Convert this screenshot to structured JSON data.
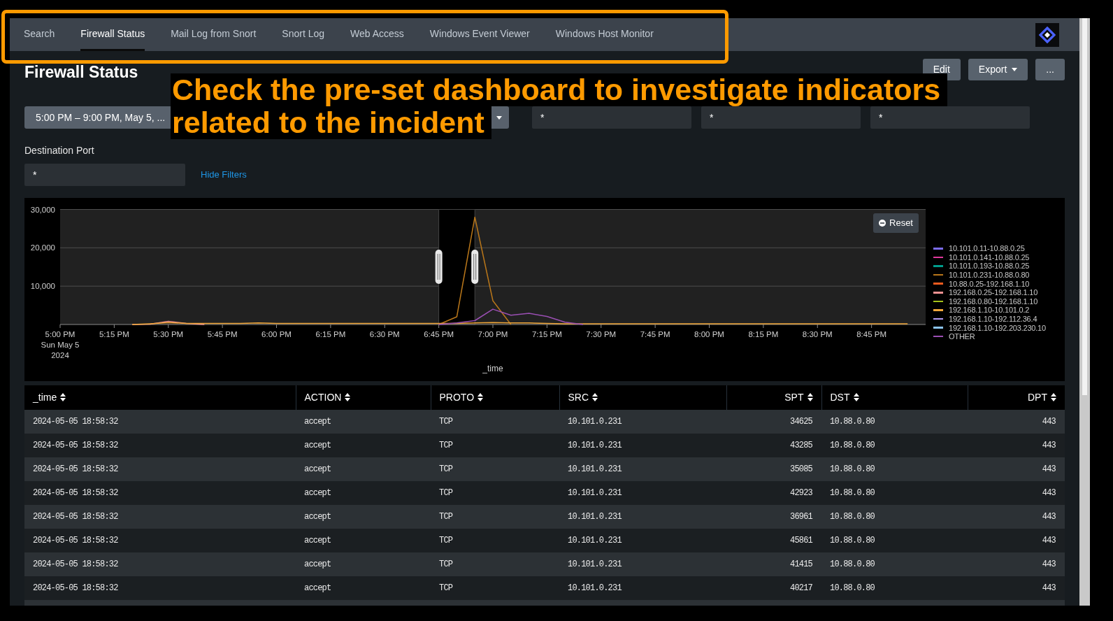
{
  "nav": {
    "tabs": [
      {
        "label": "Search",
        "selected": false
      },
      {
        "label": "Firewall Status",
        "selected": true
      },
      {
        "label": "Mail Log from Snort",
        "selected": false
      },
      {
        "label": "Snort Log",
        "selected": false
      },
      {
        "label": "Web Access",
        "selected": false
      },
      {
        "label": "Windows Event Viewer",
        "selected": false
      },
      {
        "label": "Windows Host Monitor",
        "selected": false
      }
    ]
  },
  "dashboard": {
    "title": "Firewall Status",
    "buttons": [
      {
        "label": "Edit",
        "kind": "button"
      },
      {
        "label": "Export",
        "kind": "dropdown"
      },
      {
        "label": "...",
        "kind": "button"
      }
    ]
  },
  "callout": {
    "lines": [
      "Check the pre-set dashboard to investigate indicators",
      "related to the incident"
    ]
  },
  "filters": {
    "time_range": "5:00 PM – 9:00 PM, May 5, ...",
    "inputs": [
      {
        "value": "*"
      },
      {
        "value": "*"
      },
      {
        "value": "*"
      }
    ],
    "destination_port": {
      "label": "Destination Port",
      "value": "*"
    },
    "hide_filters": "Hide Filters"
  },
  "chart": {
    "reset_button": "Reset",
    "date_lines": [
      "Sun May 5",
      "2024"
    ],
    "chart_data": {
      "type": "line",
      "xlabel": "_time",
      "legend": "right",
      "categories": [
        "5:00 PM",
        null,
        null,
        "5:15 PM",
        null,
        null,
        "5:30 PM",
        null,
        null,
        "5:45 PM",
        null,
        null,
        "6:00 PM",
        null,
        null,
        "6:15 PM",
        null,
        null,
        "6:30 PM",
        null,
        null,
        "6:45 PM",
        null,
        null,
        "7:00 PM",
        null,
        null,
        "7:15 PM",
        null,
        null,
        "7:30 PM",
        null,
        null,
        "7:45 PM",
        null,
        null,
        "8:00 PM",
        null,
        null,
        "8:15 PM",
        null,
        null,
        "8:30 PM",
        null,
        null,
        "8:45 PM",
        null,
        null,
        null
      ],
      "ylim": [
        0,
        30000
      ],
      "yticks": [
        {
          "value": 10000,
          "label": "10,000"
        },
        {
          "value": 20000,
          "label": "20,000"
        },
        {
          "value": 30000,
          "label": "30,000"
        }
      ],
      "series": [
        {
          "name": "10.101.0.11-10.88.0.25",
          "color": "#7b6cf0",
          "values": [
            null,
            null,
            null,
            null,
            null,
            null,
            null,
            null,
            null,
            null,
            null,
            null,
            null,
            null,
            null,
            null,
            null,
            null,
            null,
            null,
            null,
            null,
            null,
            null,
            null,
            null,
            null,
            null,
            null,
            null,
            null,
            null,
            null,
            null,
            null,
            null,
            null,
            null,
            null,
            null,
            null,
            null,
            null,
            null,
            null,
            null,
            null,
            null,
            null
          ]
        },
        {
          "name": "10.101.0.141-10.88.0.25",
          "color": "#e0389c",
          "values": [
            null,
            null,
            null,
            null,
            null,
            null,
            null,
            null,
            null,
            null,
            null,
            null,
            null,
            null,
            null,
            null,
            null,
            null,
            null,
            null,
            null,
            null,
            null,
            null,
            null,
            null,
            null,
            null,
            null,
            null,
            null,
            null,
            null,
            null,
            null,
            null,
            null,
            null,
            null,
            null,
            null,
            null,
            null,
            null,
            null,
            null,
            null,
            null,
            null
          ]
        },
        {
          "name": "10.101.0.193-10.88.0.25",
          "color": "#009c8c",
          "values": [
            null,
            null,
            null,
            null,
            null,
            null,
            null,
            null,
            null,
            null,
            null,
            null,
            null,
            null,
            null,
            null,
            null,
            null,
            null,
            null,
            null,
            null,
            null,
            null,
            null,
            null,
            null,
            null,
            null,
            null,
            null,
            null,
            null,
            null,
            null,
            null,
            null,
            null,
            null,
            null,
            null,
            null,
            null,
            null,
            null,
            null,
            null,
            null,
            null
          ]
        },
        {
          "name": "10.101.0.231-10.88.0.80",
          "color": "#b8761a",
          "values": [
            null,
            null,
            null,
            null,
            null,
            null,
            null,
            null,
            null,
            null,
            null,
            null,
            null,
            null,
            null,
            null,
            null,
            null,
            null,
            null,
            null,
            0,
            2000,
            28000,
            6200,
            0,
            null,
            null,
            null,
            null,
            null,
            null,
            null,
            null,
            null,
            null,
            null,
            null,
            null,
            null,
            null,
            null,
            null,
            null,
            null,
            null,
            null,
            null,
            null
          ]
        },
        {
          "name": "10.88.0.25-192.168.1.10",
          "color": "#f05a1e",
          "values": [
            null,
            null,
            null,
            null,
            null,
            null,
            null,
            null,
            null,
            null,
            null,
            null,
            null,
            null,
            null,
            null,
            null,
            null,
            null,
            null,
            null,
            null,
            null,
            null,
            null,
            null,
            null,
            null,
            null,
            null,
            null,
            null,
            null,
            null,
            null,
            null,
            null,
            null,
            null,
            null,
            null,
            null,
            null,
            null,
            null,
            null,
            null,
            null,
            null
          ]
        },
        {
          "name": "192.168.0.25-192.168.1.10",
          "color": "#f29191",
          "values": [
            null,
            null,
            null,
            null,
            0,
            100,
            800,
            300,
            0,
            null,
            null,
            null,
            null,
            null,
            null,
            null,
            null,
            null,
            null,
            null,
            null,
            null,
            null,
            null,
            null,
            null,
            null,
            null,
            null,
            null,
            null,
            null,
            null,
            null,
            null,
            null,
            null,
            null,
            null,
            null,
            null,
            null,
            null,
            null,
            null,
            null,
            null,
            null,
            null
          ]
        },
        {
          "name": "192.168.0.80-192.168.1.10",
          "color": "#a4c21a",
          "values": [
            null,
            null,
            null,
            null,
            null,
            null,
            null,
            null,
            null,
            null,
            null,
            null,
            null,
            null,
            null,
            null,
            null,
            null,
            null,
            null,
            null,
            null,
            null,
            null,
            null,
            null,
            null,
            null,
            null,
            null,
            null,
            null,
            null,
            null,
            null,
            null,
            null,
            null,
            null,
            null,
            null,
            null,
            null,
            null,
            null,
            null,
            null,
            null,
            null
          ]
        },
        {
          "name": "192.168.1.10-10.101.0.2",
          "color": "#f2a83a",
          "values": [
            null,
            null,
            null,
            null,
            0,
            200,
            500,
            300,
            300,
            300,
            300,
            400,
            300,
            300,
            300,
            300,
            300,
            300,
            300,
            300,
            300,
            300,
            300,
            400,
            500,
            400,
            400,
            300,
            200,
            200,
            200,
            200,
            200,
            200,
            200,
            200,
            200,
            200,
            200,
            200,
            200,
            200,
            200,
            200,
            200,
            200,
            200,
            200,
            null
          ]
        },
        {
          "name": "192.168.1.10-192.112.36.4",
          "color": "#b49cf5",
          "values": [
            null,
            null,
            null,
            null,
            null,
            null,
            null,
            null,
            null,
            null,
            null,
            null,
            null,
            null,
            null,
            null,
            null,
            null,
            null,
            null,
            null,
            null,
            null,
            null,
            null,
            null,
            null,
            null,
            null,
            null,
            null,
            null,
            null,
            null,
            null,
            null,
            null,
            null,
            null,
            null,
            null,
            null,
            null,
            null,
            null,
            null,
            null,
            null,
            null
          ]
        },
        {
          "name": "192.168.1.10-192.203.230.10",
          "color": "#8cc4f2",
          "values": [
            null,
            null,
            null,
            null,
            null,
            null,
            null,
            null,
            null,
            null,
            null,
            null,
            null,
            null,
            null,
            null,
            null,
            null,
            null,
            null,
            null,
            null,
            null,
            null,
            null,
            null,
            null,
            null,
            null,
            null,
            null,
            null,
            null,
            null,
            null,
            null,
            null,
            null,
            null,
            null,
            null,
            null,
            null,
            null,
            null,
            null,
            null,
            null,
            null
          ]
        },
        {
          "name": "OTHER",
          "color": "#9a4fb3",
          "values": [
            null,
            null,
            null,
            null,
            null,
            null,
            null,
            null,
            null,
            null,
            null,
            null,
            null,
            null,
            null,
            null,
            null,
            null,
            null,
            null,
            null,
            0,
            400,
            1000,
            4000,
            2400,
            2900,
            2100,
            600,
            0,
            null,
            null,
            null,
            null,
            null,
            null,
            null,
            null,
            null,
            null,
            null,
            null,
            null,
            null,
            null,
            null,
            null,
            null,
            null
          ]
        }
      ]
    }
  },
  "table": {
    "columns": [
      {
        "label": "_time",
        "kind": "text"
      },
      {
        "label": "ACTION",
        "kind": "text"
      },
      {
        "label": "PROTO",
        "kind": "text"
      },
      {
        "label": "SRC",
        "kind": "text"
      },
      {
        "label": "SPT",
        "kind": "number"
      },
      {
        "label": "DST",
        "kind": "text"
      },
      {
        "label": "DPT",
        "kind": "number"
      }
    ],
    "rows": [
      [
        "2024-05-05 18:58:32",
        "accept",
        "TCP",
        "10.101.0.231",
        "34625",
        "10.88.0.80",
        "443"
      ],
      [
        "2024-05-05 18:58:32",
        "accept",
        "TCP",
        "10.101.0.231",
        "43285",
        "10.88.0.80",
        "443"
      ],
      [
        "2024-05-05 18:58:32",
        "accept",
        "TCP",
        "10.101.0.231",
        "35085",
        "10.88.0.80",
        "443"
      ],
      [
        "2024-05-05 18:58:32",
        "accept",
        "TCP",
        "10.101.0.231",
        "42923",
        "10.88.0.80",
        "443"
      ],
      [
        "2024-05-05 18:58:32",
        "accept",
        "TCP",
        "10.101.0.231",
        "36961",
        "10.88.0.80",
        "443"
      ],
      [
        "2024-05-05 18:58:32",
        "accept",
        "TCP",
        "10.101.0.231",
        "45861",
        "10.88.0.80",
        "443"
      ],
      [
        "2024-05-05 18:58:32",
        "accept",
        "TCP",
        "10.101.0.231",
        "41415",
        "10.88.0.80",
        "443"
      ],
      [
        "2024-05-05 18:58:32",
        "accept",
        "TCP",
        "10.101.0.231",
        "40217",
        "10.88.0.80",
        "443"
      ]
    ]
  }
}
